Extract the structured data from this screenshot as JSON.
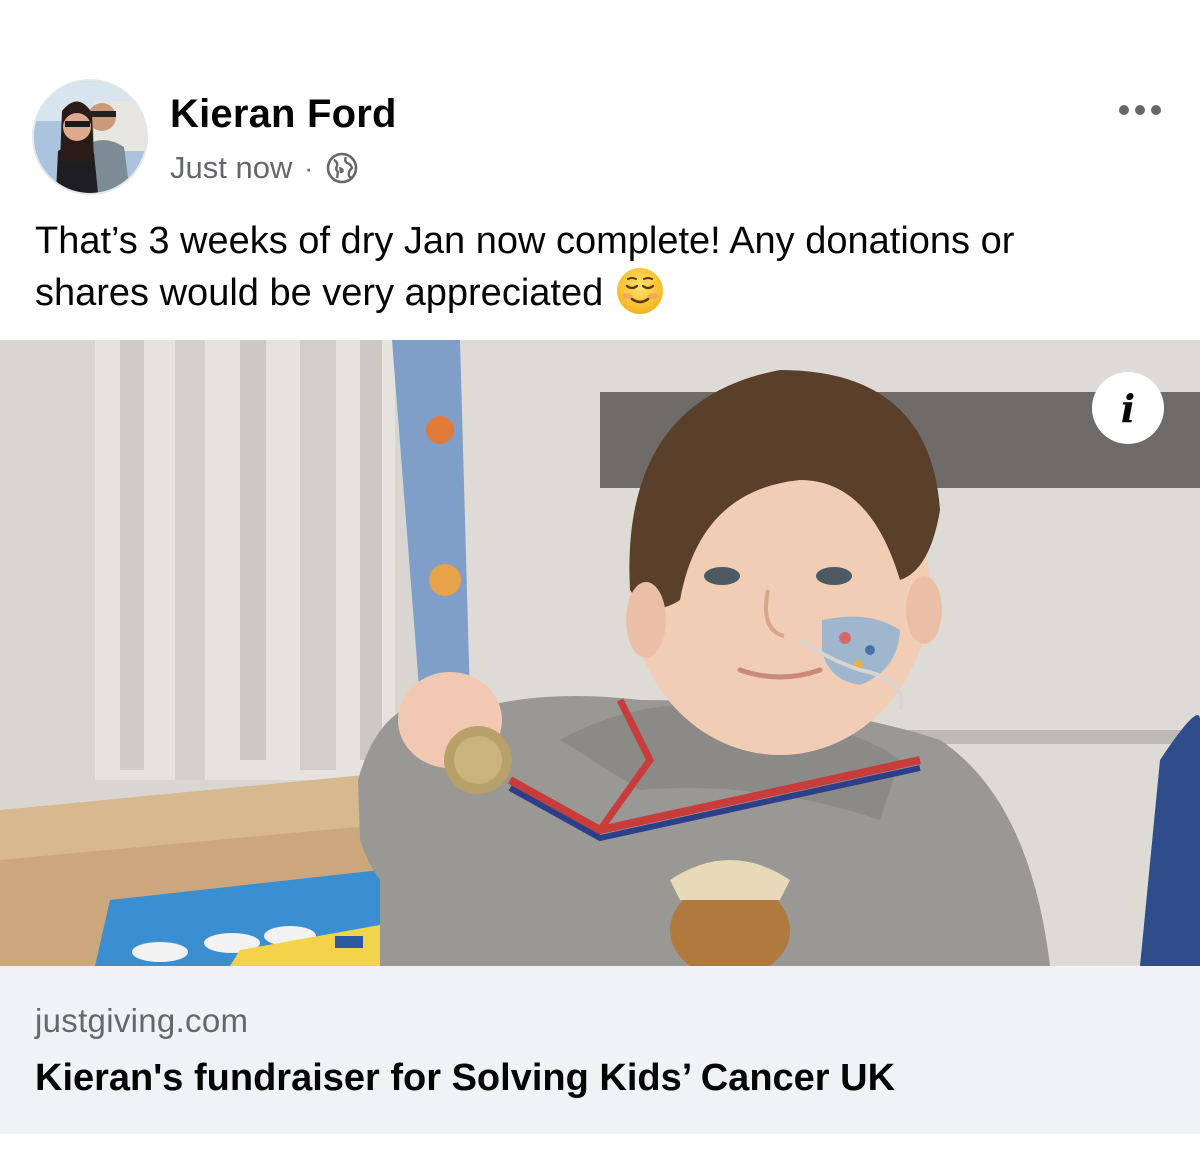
{
  "post": {
    "author_name": "Kieran Ford",
    "timestamp": "Just now",
    "separator": "·",
    "audience_icon": "globe-icon",
    "more_icon": "more-horizontal-icon",
    "text_line1": "That’s 3 weeks of dry Jan now complete! Any donations or",
    "text_line2": "shares would be very appreciated",
    "emoji": "smiling-face-emoji"
  },
  "link_preview": {
    "image_description_icon": "info-icon",
    "info_label": "i",
    "domain": "justgiving.com",
    "title": "Kieran's fundraiser for Solving Kids’ Cancer UK"
  },
  "colors": {
    "secondary_text": "#65676b",
    "link_box_bg": "#f0f2f5",
    "primary_text": "#050505"
  }
}
